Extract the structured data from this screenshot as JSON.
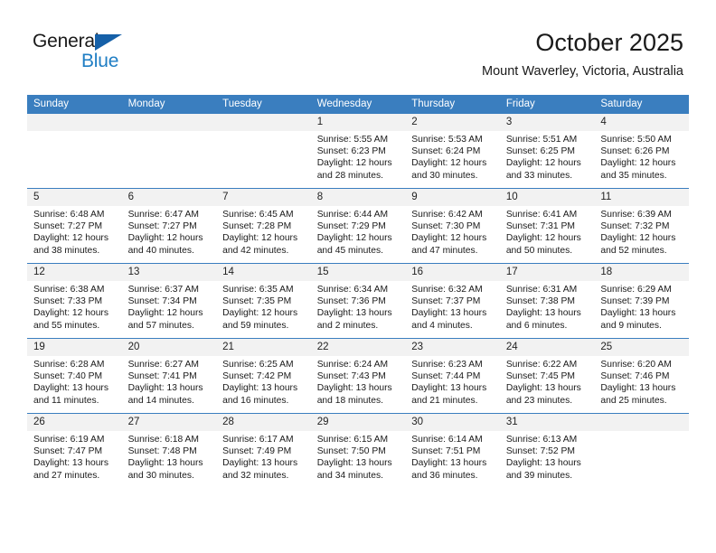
{
  "brand": {
    "name_part1": "General",
    "name_part2": "Blue",
    "triangle_color": "#1560a8",
    "blue_color": "#1f7ec4"
  },
  "header": {
    "title": "October 2025",
    "subtitle": "Mount Waverley, Victoria, Australia"
  },
  "theme": {
    "header_row_bg": "#3a7ebf",
    "daynum_bg": "#f2f2f2",
    "separator_color": "#3a7ebf"
  },
  "weekday_headers": [
    "Sunday",
    "Monday",
    "Tuesday",
    "Wednesday",
    "Thursday",
    "Friday",
    "Saturday"
  ],
  "labels": {
    "sunrise_prefix": "Sunrise:",
    "sunset_prefix": "Sunset:",
    "daylight_prefix": "Daylight:"
  },
  "weeks": [
    [
      {
        "day": "",
        "empty": true
      },
      {
        "day": "",
        "empty": true
      },
      {
        "day": "",
        "empty": true
      },
      {
        "day": "1",
        "sunrise": "Sunrise: 5:55 AM",
        "sunset": "Sunset: 6:23 PM",
        "daylight": "Daylight: 12 hours and 28 minutes."
      },
      {
        "day": "2",
        "sunrise": "Sunrise: 5:53 AM",
        "sunset": "Sunset: 6:24 PM",
        "daylight": "Daylight: 12 hours and 30 minutes."
      },
      {
        "day": "3",
        "sunrise": "Sunrise: 5:51 AM",
        "sunset": "Sunset: 6:25 PM",
        "daylight": "Daylight: 12 hours and 33 minutes."
      },
      {
        "day": "4",
        "sunrise": "Sunrise: 5:50 AM",
        "sunset": "Sunset: 6:26 PM",
        "daylight": "Daylight: 12 hours and 35 minutes."
      }
    ],
    [
      {
        "day": "5",
        "sunrise": "Sunrise: 6:48 AM",
        "sunset": "Sunset: 7:27 PM",
        "daylight": "Daylight: 12 hours and 38 minutes."
      },
      {
        "day": "6",
        "sunrise": "Sunrise: 6:47 AM",
        "sunset": "Sunset: 7:27 PM",
        "daylight": "Daylight: 12 hours and 40 minutes."
      },
      {
        "day": "7",
        "sunrise": "Sunrise: 6:45 AM",
        "sunset": "Sunset: 7:28 PM",
        "daylight": "Daylight: 12 hours and 42 minutes."
      },
      {
        "day": "8",
        "sunrise": "Sunrise: 6:44 AM",
        "sunset": "Sunset: 7:29 PM",
        "daylight": "Daylight: 12 hours and 45 minutes."
      },
      {
        "day": "9",
        "sunrise": "Sunrise: 6:42 AM",
        "sunset": "Sunset: 7:30 PM",
        "daylight": "Daylight: 12 hours and 47 minutes."
      },
      {
        "day": "10",
        "sunrise": "Sunrise: 6:41 AM",
        "sunset": "Sunset: 7:31 PM",
        "daylight": "Daylight: 12 hours and 50 minutes."
      },
      {
        "day": "11",
        "sunrise": "Sunrise: 6:39 AM",
        "sunset": "Sunset: 7:32 PM",
        "daylight": "Daylight: 12 hours and 52 minutes."
      }
    ],
    [
      {
        "day": "12",
        "sunrise": "Sunrise: 6:38 AM",
        "sunset": "Sunset: 7:33 PM",
        "daylight": "Daylight: 12 hours and 55 minutes."
      },
      {
        "day": "13",
        "sunrise": "Sunrise: 6:37 AM",
        "sunset": "Sunset: 7:34 PM",
        "daylight": "Daylight: 12 hours and 57 minutes."
      },
      {
        "day": "14",
        "sunrise": "Sunrise: 6:35 AM",
        "sunset": "Sunset: 7:35 PM",
        "daylight": "Daylight: 12 hours and 59 minutes."
      },
      {
        "day": "15",
        "sunrise": "Sunrise: 6:34 AM",
        "sunset": "Sunset: 7:36 PM",
        "daylight": "Daylight: 13 hours and 2 minutes."
      },
      {
        "day": "16",
        "sunrise": "Sunrise: 6:32 AM",
        "sunset": "Sunset: 7:37 PM",
        "daylight": "Daylight: 13 hours and 4 minutes."
      },
      {
        "day": "17",
        "sunrise": "Sunrise: 6:31 AM",
        "sunset": "Sunset: 7:38 PM",
        "daylight": "Daylight: 13 hours and 6 minutes."
      },
      {
        "day": "18",
        "sunrise": "Sunrise: 6:29 AM",
        "sunset": "Sunset: 7:39 PM",
        "daylight": "Daylight: 13 hours and 9 minutes."
      }
    ],
    [
      {
        "day": "19",
        "sunrise": "Sunrise: 6:28 AM",
        "sunset": "Sunset: 7:40 PM",
        "daylight": "Daylight: 13 hours and 11 minutes."
      },
      {
        "day": "20",
        "sunrise": "Sunrise: 6:27 AM",
        "sunset": "Sunset: 7:41 PM",
        "daylight": "Daylight: 13 hours and 14 minutes."
      },
      {
        "day": "21",
        "sunrise": "Sunrise: 6:25 AM",
        "sunset": "Sunset: 7:42 PM",
        "daylight": "Daylight: 13 hours and 16 minutes."
      },
      {
        "day": "22",
        "sunrise": "Sunrise: 6:24 AM",
        "sunset": "Sunset: 7:43 PM",
        "daylight": "Daylight: 13 hours and 18 minutes."
      },
      {
        "day": "23",
        "sunrise": "Sunrise: 6:23 AM",
        "sunset": "Sunset: 7:44 PM",
        "daylight": "Daylight: 13 hours and 21 minutes."
      },
      {
        "day": "24",
        "sunrise": "Sunrise: 6:22 AM",
        "sunset": "Sunset: 7:45 PM",
        "daylight": "Daylight: 13 hours and 23 minutes."
      },
      {
        "day": "25",
        "sunrise": "Sunrise: 6:20 AM",
        "sunset": "Sunset: 7:46 PM",
        "daylight": "Daylight: 13 hours and 25 minutes."
      }
    ],
    [
      {
        "day": "26",
        "sunrise": "Sunrise: 6:19 AM",
        "sunset": "Sunset: 7:47 PM",
        "daylight": "Daylight: 13 hours and 27 minutes."
      },
      {
        "day": "27",
        "sunrise": "Sunrise: 6:18 AM",
        "sunset": "Sunset: 7:48 PM",
        "daylight": "Daylight: 13 hours and 30 minutes."
      },
      {
        "day": "28",
        "sunrise": "Sunrise: 6:17 AM",
        "sunset": "Sunset: 7:49 PM",
        "daylight": "Daylight: 13 hours and 32 minutes."
      },
      {
        "day": "29",
        "sunrise": "Sunrise: 6:15 AM",
        "sunset": "Sunset: 7:50 PM",
        "daylight": "Daylight: 13 hours and 34 minutes."
      },
      {
        "day": "30",
        "sunrise": "Sunrise: 6:14 AM",
        "sunset": "Sunset: 7:51 PM",
        "daylight": "Daylight: 13 hours and 36 minutes."
      },
      {
        "day": "31",
        "sunrise": "Sunrise: 6:13 AM",
        "sunset": "Sunset: 7:52 PM",
        "daylight": "Daylight: 13 hours and 39 minutes."
      },
      {
        "day": "",
        "empty": true
      }
    ]
  ]
}
